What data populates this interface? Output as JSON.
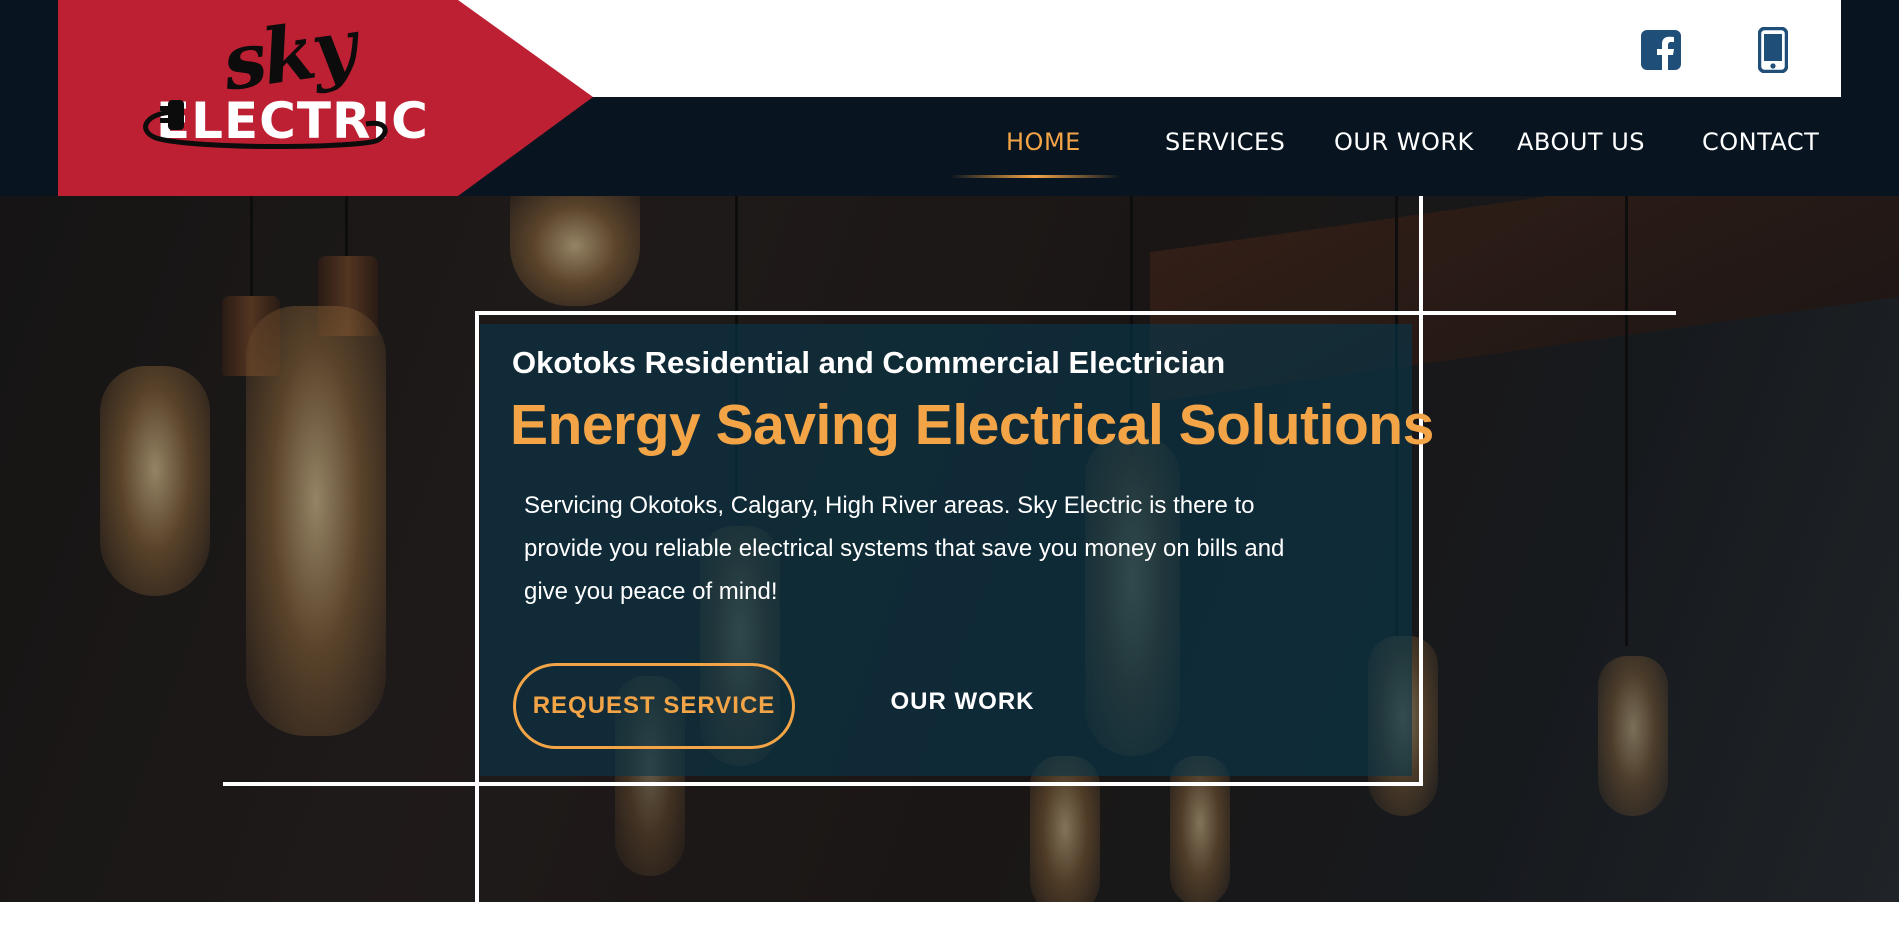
{
  "brand": {
    "logo_top": "sky",
    "logo_bottom": "ELECTRIC",
    "color_red": "#be2033",
    "color_navy": "#081520",
    "color_accent": "#f3a446"
  },
  "header": {
    "social_icons": [
      {
        "name": "facebook-icon",
        "color": "#1f4e79"
      },
      {
        "name": "phone-icon",
        "color": "#1f4e79"
      }
    ],
    "nav": [
      {
        "label": "HOME",
        "active": true
      },
      {
        "label": "SERVICES",
        "active": false
      },
      {
        "label": "OUR WORK",
        "active": false
      },
      {
        "label": "ABOUT US",
        "active": false
      },
      {
        "label": "CONTACT",
        "active": false
      }
    ]
  },
  "hero": {
    "subtitle": "Okotoks Residential and Commercial Electrician",
    "headline": "Energy Saving Electrical Solutions",
    "description": "Servicing Okotoks, Calgary, High River areas. Sky Electric is there to provide you reliable electrical systems that save you money on bills and give you peace of mind!",
    "primary_button": "REQUEST SERVICE",
    "secondary_button": "OUR WORK"
  }
}
